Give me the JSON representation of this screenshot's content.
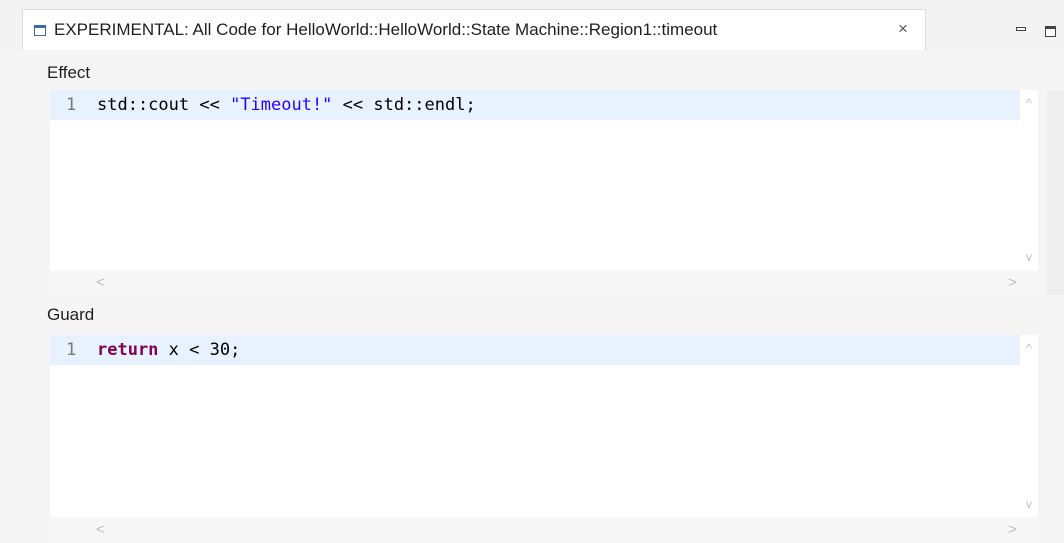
{
  "view_tab": {
    "icon": "view-window-icon",
    "title": "EXPERIMENTAL: All Code for HelloWorld::HelloWorld::State Machine::Region1::timeout",
    "close_glyph": "×"
  },
  "window_controls": {
    "minimize_icon": "minimize-icon",
    "maximize_icon": "maximize-icon"
  },
  "sections": {
    "effect": {
      "label": "Effect",
      "lines": [
        {
          "number": "1",
          "tokens": [
            "std::cout << ",
            "\"Timeout!\"",
            " << std::endl;"
          ]
        }
      ]
    },
    "guard": {
      "label": "Guard",
      "lines": [
        {
          "number": "1",
          "tokens": [
            "return",
            " x < 30;"
          ]
        }
      ]
    }
  },
  "scroll_glyphs": {
    "up": "^",
    "down": "v",
    "left": "<",
    "right": ">"
  },
  "colors": {
    "current_line": "#e8f2fe",
    "string": "#2a00ff",
    "keyword": "#7f0055",
    "line_number": "#787878"
  }
}
